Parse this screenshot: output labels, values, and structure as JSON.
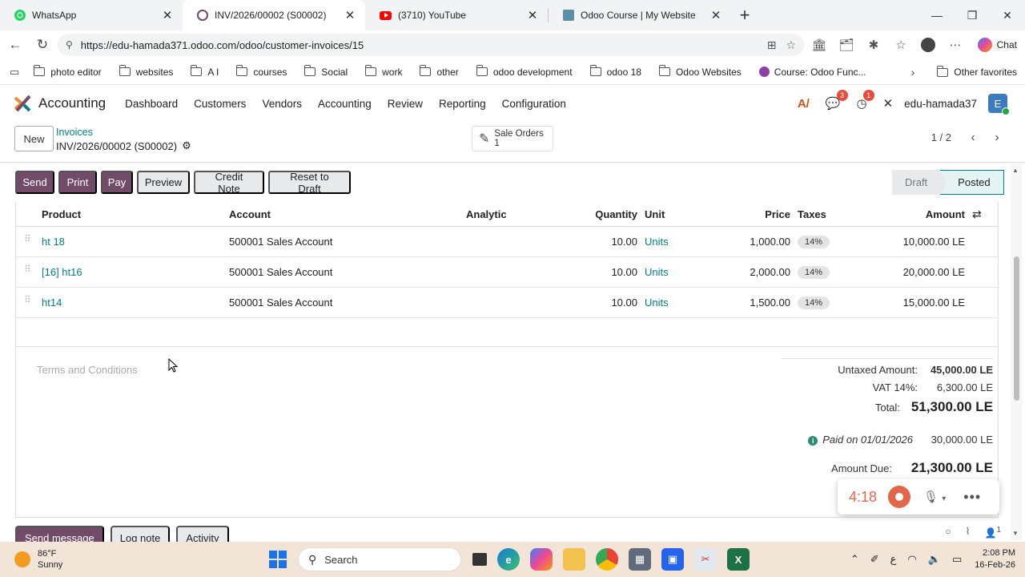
{
  "browser": {
    "tabs": [
      {
        "title": "WhatsApp",
        "active": false,
        "color": "#25d366"
      },
      {
        "title": "INV/2026/00002 (S00002)",
        "active": true,
        "color": "#714b67"
      },
      {
        "title": "(3710) YouTube",
        "active": false,
        "color": "#ff0000"
      },
      {
        "title": "Odoo Course | My Website",
        "active": false,
        "color": "#5b8fa8"
      }
    ],
    "url": "https://edu-hamada371.odoo.com/odoo/customer-invoices/15",
    "chat_label": "Chat",
    "bookmarks": [
      "photo editor",
      "websites",
      "A I",
      "courses",
      "Social",
      "work",
      "other",
      "odoo development",
      "odoo 18",
      "Odoo Websites",
      "Course: Odoo Func..."
    ],
    "other_favorites": "Other favorites"
  },
  "odoo": {
    "app_name": "Accounting",
    "menu": [
      "Dashboard",
      "Customers",
      "Vendors",
      "Accounting",
      "Review",
      "Reporting",
      "Configuration"
    ],
    "messages_badge": "3",
    "activity_badge": "1",
    "user": "edu-hamada37",
    "avatar_letter": "E",
    "accent": "#714b67",
    "link_color": "#017e84"
  },
  "control_panel": {
    "new_label": "New",
    "breadcrumb_parent": "Invoices",
    "breadcrumb_current": "INV/2026/00002 (S00002)",
    "smart_button_label": "Sale Orders",
    "smart_button_count": "1",
    "pager": "1 / 2"
  },
  "statusbar": {
    "buttons": [
      "Send",
      "Print",
      "Pay",
      "Preview",
      "Credit Note",
      "Reset to Draft"
    ],
    "states": [
      "Draft",
      "Posted"
    ],
    "current_state": "Posted"
  },
  "lines": {
    "headers": {
      "product": "Product",
      "account": "Account",
      "analytic": "Analytic",
      "quantity": "Quantity",
      "unit": "Unit",
      "price": "Price",
      "taxes": "Taxes",
      "amount": "Amount"
    },
    "rows": [
      {
        "product": "ht 18",
        "account": "500001 Sales Account",
        "quantity": "10.00",
        "unit": "Units",
        "price": "1,000.00",
        "tax": "14%",
        "amount": "10,000.00 LE"
      },
      {
        "product": "[16] ht16",
        "account": "500001 Sales Account",
        "quantity": "10.00",
        "unit": "Units",
        "price": "2,000.00",
        "tax": "14%",
        "amount": "20,000.00 LE"
      },
      {
        "product": "ht14",
        "account": "500001 Sales Account",
        "quantity": "10.00",
        "unit": "Units",
        "price": "1,500.00",
        "tax": "14%",
        "amount": "15,000.00 LE"
      }
    ]
  },
  "terms_placeholder": "Terms and Conditions",
  "totals": {
    "untaxed_label": "Untaxed Amount:",
    "untaxed_value": "45,000.00 LE",
    "vat_label": "VAT 14%:",
    "vat_value": "6,300.00 LE",
    "total_label": "Total:",
    "total_value": "51,300.00 LE",
    "paid_label": "Paid on 01/01/2026",
    "paid_value": "30,000.00 LE",
    "due_label": "Amount Due:",
    "due_value": "21,300.00 LE"
  },
  "chatter": {
    "send_message": "Send message",
    "log_note": "Log note",
    "activity": "Activity",
    "followers": "1"
  },
  "recorder": {
    "time": "4:18"
  },
  "taskbar": {
    "temperature": "86°F",
    "condition": "Sunny",
    "search_placeholder": "Search",
    "language": "ع",
    "time": "2:08 PM",
    "date": "16-Feb-26"
  }
}
